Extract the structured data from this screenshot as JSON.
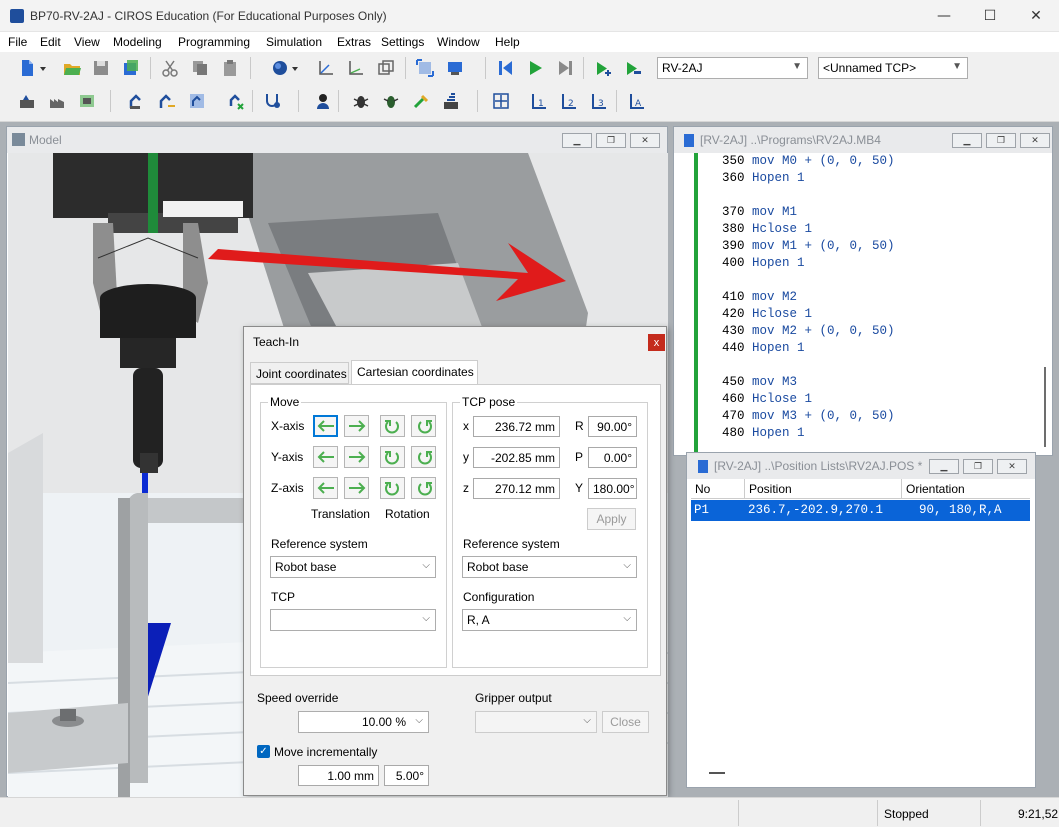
{
  "window": {
    "title": "BP70-RV-2AJ - CIROS Education (For Educational Purposes Only)",
    "minimize": "—",
    "maximize": "☐",
    "close": "✕"
  },
  "menu": [
    "File",
    "Edit",
    "View",
    "Modeling",
    "Programming",
    "Simulation",
    "Extras",
    "Settings",
    "Window",
    "Help"
  ],
  "toolbar": {
    "robot_select": "RV-2AJ",
    "tcp_select": "<Unnamed TCP>"
  },
  "model_window": {
    "title": "Model"
  },
  "program_window": {
    "title": "[RV-2AJ] ..\\Programs\\RV2AJ.MB4",
    "lines": [
      {
        "num": "350",
        "cmd": "mov M0 + (0, 0, 50)"
      },
      {
        "num": "360",
        "cmd": "Hopen 1"
      },
      {
        "num": "",
        "cmd": ""
      },
      {
        "num": "370",
        "cmd": "mov M1"
      },
      {
        "num": "380",
        "cmd": "Hclose 1"
      },
      {
        "num": "390",
        "cmd": "mov M1 + (0, 0, 50)"
      },
      {
        "num": "400",
        "cmd": "Hopen 1"
      },
      {
        "num": "",
        "cmd": ""
      },
      {
        "num": "410",
        "cmd": "mov M2"
      },
      {
        "num": "420",
        "cmd": "Hclose 1"
      },
      {
        "num": "430",
        "cmd": "mov M2 + (0, 0, 50)"
      },
      {
        "num": "440",
        "cmd": "Hopen 1"
      },
      {
        "num": "",
        "cmd": ""
      },
      {
        "num": "450",
        "cmd": "mov M3"
      },
      {
        "num": "460",
        "cmd": "Hclose 1"
      },
      {
        "num": "470",
        "cmd": "mov M3 + (0, 0, 50)"
      },
      {
        "num": "480",
        "cmd": "Hopen 1"
      }
    ]
  },
  "poslist_window": {
    "title": "[RV-2AJ] ..\\Position Lists\\RV2AJ.POS *",
    "headers": [
      "No",
      "Position",
      "Orientation"
    ],
    "rows": [
      {
        "no": "P1",
        "position": "236.7,-202.9,270.1",
        "orientation": "90, 180,R,A"
      }
    ]
  },
  "teachin": {
    "title": "Teach-In",
    "close": "x",
    "tabs": [
      "Joint coordinates",
      "Cartesian coordinates"
    ],
    "move": {
      "title": "Move",
      "axes": [
        "X-axis",
        "Y-axis",
        "Z-axis"
      ],
      "translation": "Translation",
      "rotation": "Rotation",
      "refsys_label": "Reference system",
      "refsys_value": "Robot base",
      "tcp_label": "TCP",
      "tcp_value": ""
    },
    "pose": {
      "title": "TCP pose",
      "x_label": "x",
      "x": "236.72 mm",
      "y_label": "y",
      "y": "-202.85 mm",
      "z_label": "z",
      "z": "270.12 mm",
      "r_label": "R",
      "r": "90.00°",
      "p_label": "P",
      "p": "0.00°",
      "yaw_label": "Y",
      "yaw": "180.00°",
      "apply": "Apply",
      "refsys_label": "Reference system",
      "refsys_value": "Robot base",
      "config_label": "Configuration",
      "config_value": "R, A"
    },
    "speed_label": "Speed override",
    "speed_value": "10.00 %",
    "gripper_label": "Gripper output",
    "gripper_value": "",
    "gripper_close": "Close",
    "move_inc_label": "Move incrementally",
    "move_inc_checked": true,
    "inc_mm": "1.00 mm",
    "inc_deg": "5.00°"
  },
  "status": {
    "state": "Stopped",
    "time": "9:21,52"
  },
  "colors": {
    "accent": "#0078d7",
    "keyword": "#1a4aa0",
    "green": "#22a33a"
  }
}
